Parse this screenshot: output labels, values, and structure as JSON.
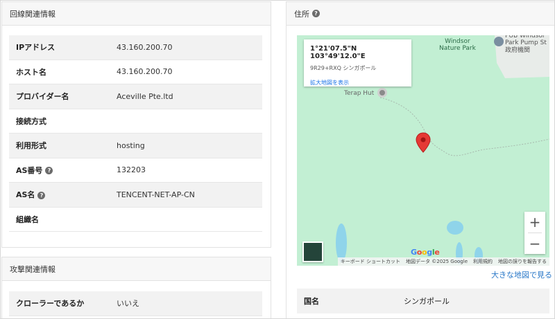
{
  "line_section": {
    "title": "回線関連情報",
    "rows": [
      {
        "key": "IPアドレス",
        "value": "43.160.200.70",
        "help": false
      },
      {
        "key": "ホスト名",
        "value": "43.160.200.70",
        "help": false
      },
      {
        "key": "プロバイダー名",
        "value": "Aceville Pte.ltd",
        "help": false
      },
      {
        "key": "接続方式",
        "value": "",
        "help": false
      },
      {
        "key": "利用形式",
        "value": "hosting",
        "help": false
      },
      {
        "key": "AS番号",
        "value": "132203",
        "help": true
      },
      {
        "key": "AS名",
        "value": "TENCENT-NET-AP-CN",
        "help": true
      },
      {
        "key": "組織名",
        "value": "",
        "help": false
      }
    ]
  },
  "attack_section": {
    "title": "攻撃関連情報",
    "rows": [
      {
        "key": "クローラーであるか",
        "value": "いいえ"
      }
    ]
  },
  "address_section": {
    "title": "住所",
    "help_glyph": "?",
    "map": {
      "coords": "1°21'07.5\"N 103°49'12.0\"E",
      "plus_code": "9R29+RXQ シンガポール",
      "enlarge_link": "拡大地図を表示",
      "labels": {
        "windsor": "Windsor\nNature Park",
        "pub": "PUB Windsor\nPark Pump St",
        "gov": "政府機関",
        "terap": "Terap Hut"
      },
      "zoom_in": "+",
      "zoom_out": "−",
      "google": [
        "G",
        "o",
        "o",
        "g",
        "l",
        "e"
      ],
      "google_colors": [
        "#4285F4",
        "#EA4335",
        "#FBBC05",
        "#4285F4",
        "#34A853",
        "#EA4335"
      ],
      "attribution": [
        "キーボード ショートカット",
        "地図データ ©2025 Google",
        "利用規約",
        "地図の誤りを報告する"
      ]
    },
    "big_map_link": "大きな地図で見る",
    "country": {
      "key": "国名",
      "value": "シンガポール"
    }
  },
  "colors": {
    "marker": "#e53935",
    "link": "#2a78c8",
    "map_bg": "#c2efd3",
    "water": "#8fd4ea"
  }
}
